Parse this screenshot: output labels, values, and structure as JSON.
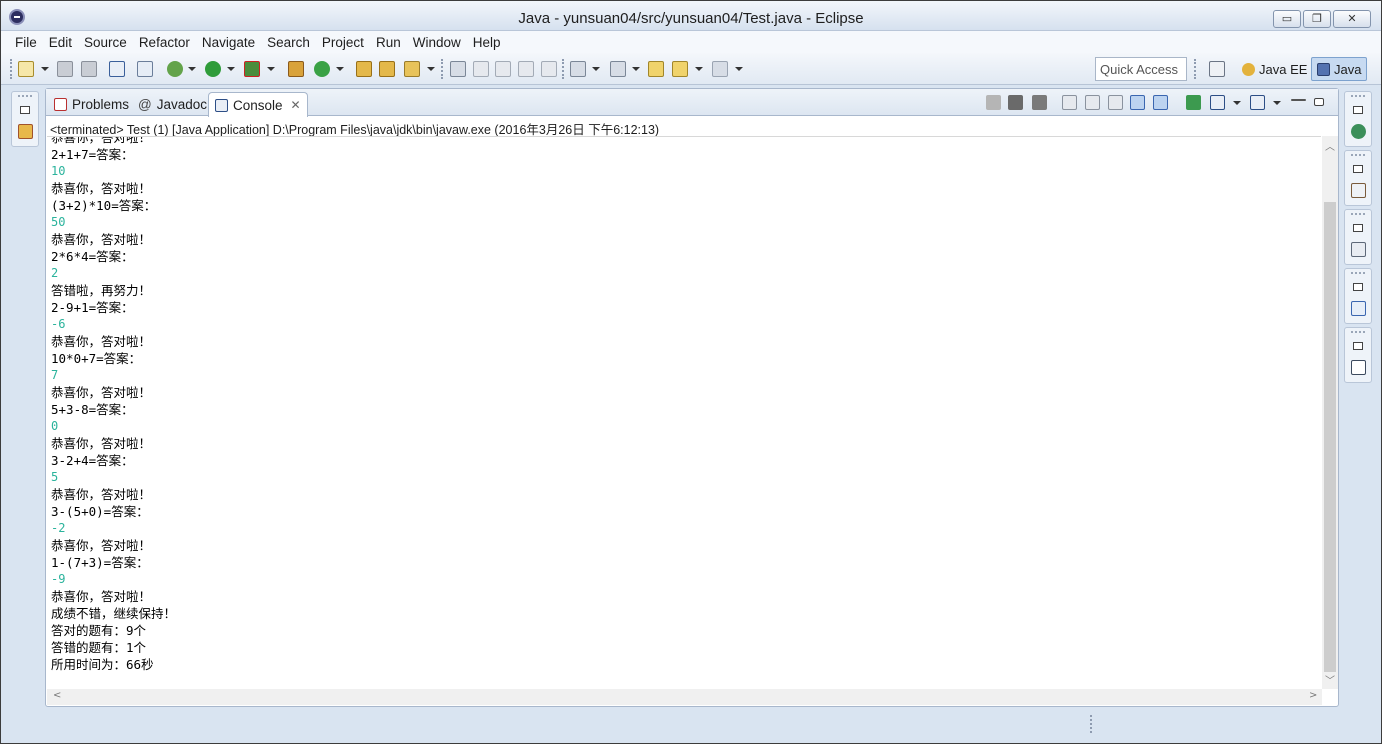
{
  "window": {
    "title": "Java - yunsuan04/src/yunsuan04/Test.java - Eclipse"
  },
  "window_buttons": {
    "minimize": "▭",
    "restore": "❐",
    "close": "✕"
  },
  "menu": [
    "File",
    "Edit",
    "Source",
    "Refactor",
    "Navigate",
    "Search",
    "Project",
    "Run",
    "Window",
    "Help"
  ],
  "toolbar": {
    "quick_access_placeholder": "Quick Access",
    "perspectives": [
      {
        "label": "Java EE",
        "icon": "java-ee-perspective-icon",
        "active": false
      },
      {
        "label": "Java",
        "icon": "java-perspective-icon",
        "active": true
      }
    ]
  },
  "tabs": [
    {
      "label": "Problems",
      "icon": "problems-icon",
      "active": false
    },
    {
      "label": "Javadoc",
      "icon": "javadoc-at-icon",
      "prefix": "@",
      "active": false
    },
    {
      "label": "Console",
      "icon": "console-icon",
      "active": true,
      "close": "✕"
    }
  ],
  "console": {
    "process": "<terminated> Test (1) [Java Application] D:\\Program Files\\java\\jdk\\bin\\javaw.exe (2016年3月26日 下午6:12:13)",
    "lines": [
      {
        "text": "恭喜你，答对啦！",
        "type": "output"
      },
      {
        "text": "2+1+7=答案：",
        "type": "output"
      },
      {
        "text": "10",
        "type": "input"
      },
      {
        "text": "恭喜你，答对啦！",
        "type": "output"
      },
      {
        "text": "(3+2)*10=答案：",
        "type": "output"
      },
      {
        "text": "50",
        "type": "input"
      },
      {
        "text": "恭喜你，答对啦！",
        "type": "output"
      },
      {
        "text": "2*6*4=答案：",
        "type": "output"
      },
      {
        "text": "2",
        "type": "input"
      },
      {
        "text": "答错啦，再努力！",
        "type": "output"
      },
      {
        "text": "2-9+1=答案：",
        "type": "output"
      },
      {
        "text": "-6",
        "type": "input"
      },
      {
        "text": "恭喜你，答对啦！",
        "type": "output"
      },
      {
        "text": "10*0+7=答案：",
        "type": "output"
      },
      {
        "text": "7",
        "type": "input"
      },
      {
        "text": "恭喜你，答对啦！",
        "type": "output"
      },
      {
        "text": "5+3-8=答案：",
        "type": "output"
      },
      {
        "text": "0",
        "type": "input"
      },
      {
        "text": "恭喜你，答对啦！",
        "type": "output"
      },
      {
        "text": "3-2+4=答案：",
        "type": "output"
      },
      {
        "text": "5",
        "type": "input"
      },
      {
        "text": "恭喜你，答对啦！",
        "type": "output"
      },
      {
        "text": "3-(5+0)=答案：",
        "type": "output"
      },
      {
        "text": "-2",
        "type": "input"
      },
      {
        "text": "恭喜你，答对啦！",
        "type": "output"
      },
      {
        "text": "1-(7+3)=答案：",
        "type": "output"
      },
      {
        "text": "-9",
        "type": "input"
      },
      {
        "text": "恭喜你，答对啦！",
        "type": "output"
      },
      {
        "text": "成绩不错，继续保持！",
        "type": "output"
      },
      {
        "text": "答对的题有：9个",
        "type": "output"
      },
      {
        "text": "答错的题有：1个",
        "type": "output"
      },
      {
        "text": "所用时间为：66秒",
        "type": "output"
      }
    ]
  },
  "colors": {
    "input_text": "#2bb39c",
    "active_perspective": "#c7daf1",
    "chrome": "#d9e4f1"
  }
}
